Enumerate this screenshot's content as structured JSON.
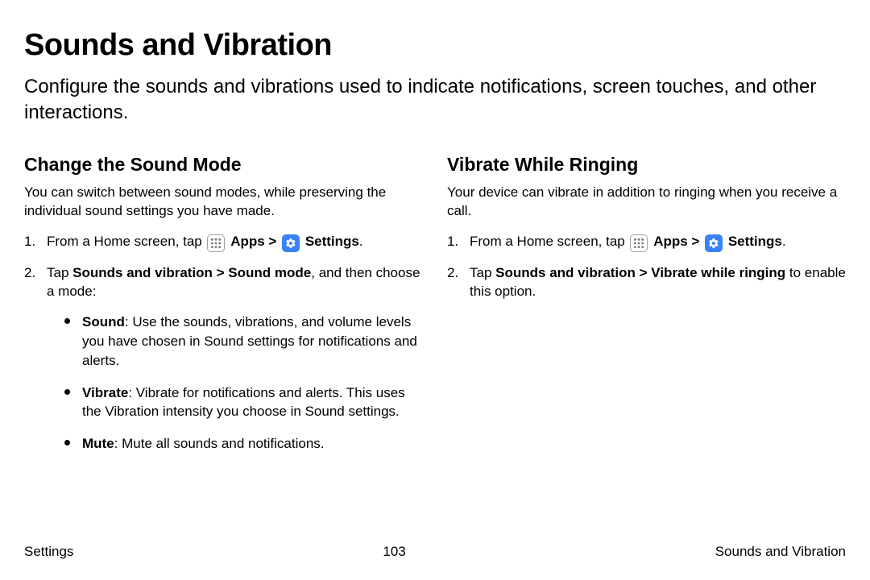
{
  "title": "Sounds and Vibration",
  "subtitle": "Configure the sounds and vibrations used to indicate notifications, screen touches, and other interactions.",
  "left": {
    "heading": "Change the Sound Mode",
    "intro": "You can switch between sound modes, while preserving the individual sound settings you have made.",
    "step1_prefix": "From a Home screen, tap ",
    "apps_label": "Apps",
    "sep": " > ",
    "settings_label": "Settings",
    "period": ".",
    "step2_a": "Tap ",
    "step2_b": "Sounds and vibration > Sound mode",
    "step2_c": ", and then choose a mode:",
    "bullet1_a": "Sound",
    "bullet1_b": ": Use the sounds, vibrations, and volume levels you have chosen in Sound settings for notifications and alerts.",
    "bullet2_a": "Vibrate",
    "bullet2_b": ": Vibrate for notifications and alerts. This uses the Vibration intensity you choose in Sound settings.",
    "bullet3_a": "Mute",
    "bullet3_b": ": Mute all sounds and notifications."
  },
  "right": {
    "heading": "Vibrate While Ringing",
    "intro": "Your device can vibrate in addition to ringing when you receive a call.",
    "step1_prefix": "From a Home screen, tap ",
    "apps_label": "Apps",
    "sep": " > ",
    "settings_label": "Settings",
    "period": ".",
    "step2_a": "Tap ",
    "step2_b": "Sounds and vibration > Vibrate while ringing",
    "step2_c": " to enable this option."
  },
  "footer": {
    "left": "Settings",
    "center": "103",
    "right": "Sounds and Vibration"
  }
}
